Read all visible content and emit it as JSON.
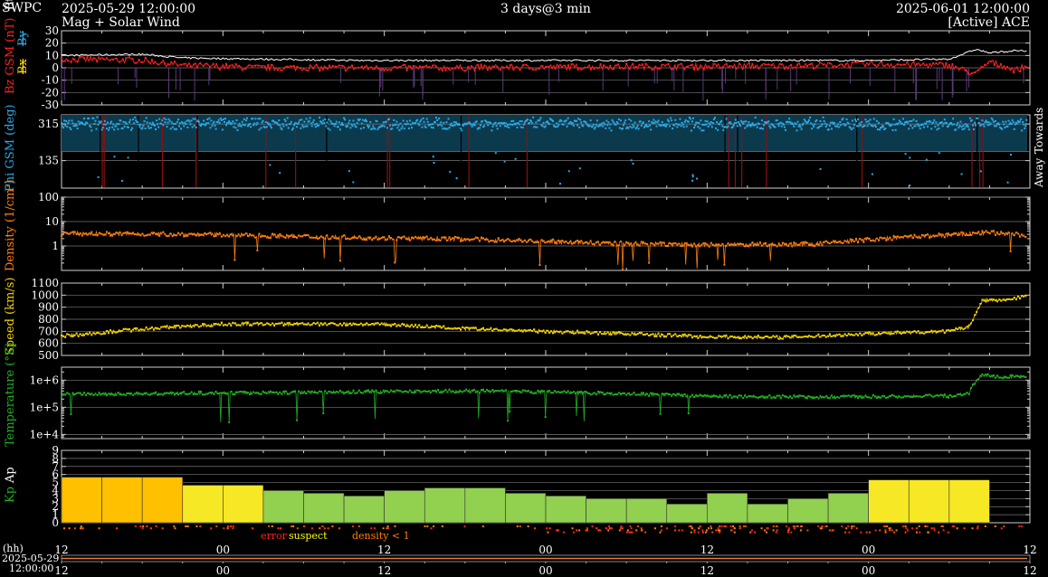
{
  "header": {
    "org": "SWPC",
    "start_time": "2025-05-29 12:00:00",
    "span": "3 days@3 min",
    "end_time": "2025-06-01 12:00:00",
    "title": "Mag + Solar Wind",
    "source": "[Active] ACE"
  },
  "colors": {
    "bz": "#ff2020",
    "bt": "#ffffff",
    "bx": "#ffd700",
    "by": "#29a9e8",
    "phi": "#29a9e8",
    "phi_fill": "#0b3a4d",
    "density": "#ff7f10",
    "speed": "#f2d200",
    "temp": "#22b022",
    "kp_green": "#92d050",
    "kp_yellow": "#f6e824",
    "kp_orange": "#ffc000",
    "error": "#ff2020",
    "suspect": "#ffff00",
    "low_density": "#ff7f10",
    "grid": "#777777"
  },
  "legend": {
    "error": "error",
    "suspect": "suspect",
    "density": "density < 1"
  },
  "chart_data": [
    {
      "type": "line",
      "name": "mag",
      "ylabel_parts": [
        "Bz GSM (nT)",
        "Bt"
      ],
      "sublabel_parts": [
        "Bx",
        "By"
      ],
      "ylim": [
        -30,
        30
      ],
      "yticks": [
        30,
        20,
        10,
        0,
        -10,
        -20,
        -30
      ],
      "x_hours": [
        0,
        6,
        9,
        15,
        22,
        30,
        40,
        48,
        56,
        60,
        66,
        68,
        69,
        71,
        72
      ],
      "bt": [
        10,
        11,
        8,
        7,
        6,
        6,
        6,
        6,
        6,
        6,
        7,
        15,
        12,
        14,
        13
      ],
      "bz": [
        7,
        6,
        2,
        0,
        0,
        0,
        1,
        1,
        2,
        3,
        2,
        -5,
        5,
        -2,
        3
      ]
    },
    {
      "type": "scatter",
      "name": "phi",
      "ylabel_parts": [
        "Phi GSM (deg)"
      ],
      "right_labels": [
        "Away",
        "Towards"
      ],
      "ylim": [
        0,
        360
      ],
      "yticks": [
        315,
        135
      ],
      "band_ylim": [
        180,
        360
      ],
      "typical": [
        300,
        330
      ]
    },
    {
      "type": "line",
      "name": "density",
      "ylabel": "Density (1/cm³)",
      "scale": "log",
      "ylim": [
        0.1,
        100
      ],
      "yticks": [
        "100",
        "10",
        "1"
      ],
      "x_hours": [
        0,
        10,
        20,
        30,
        40,
        48,
        56,
        60,
        66,
        69,
        71.5
      ],
      "values": [
        3.2,
        3.0,
        2.3,
        1.9,
        1.3,
        1.1,
        1.2,
        1.8,
        2.8,
        3.5,
        2.8
      ]
    },
    {
      "type": "line",
      "name": "speed",
      "ylabel": "Speed (km/s)",
      "ylim": [
        500,
        1100
      ],
      "yticks": [
        1100,
        1000,
        900,
        800,
        700,
        600,
        500
      ],
      "x_hours": [
        0,
        6,
        12,
        18,
        24,
        30,
        36,
        42,
        48,
        54,
        60,
        66,
        67.5,
        68.5,
        70,
        71.5
      ],
      "values": [
        660,
        720,
        760,
        760,
        760,
        720,
        700,
        680,
        655,
        650,
        680,
        700,
        740,
        960,
        955,
        990
      ]
    },
    {
      "type": "line",
      "name": "temperature",
      "ylabel": "Temperature (°K)",
      "scale": "log",
      "ylim": [
        7000,
        3000000
      ],
      "yticks": [
        "1e+6",
        "1e+5",
        "1e+4"
      ],
      "x_hours": [
        0,
        10,
        20,
        30,
        40,
        48,
        56,
        60,
        66,
        67.5,
        68.5,
        70,
        71.5
      ],
      "values": [
        300000,
        330000,
        360000,
        400000,
        330000,
        260000,
        240000,
        250000,
        260000,
        330000,
        1500000,
        1300000,
        1400000
      ]
    },
    {
      "type": "bar",
      "name": "kp",
      "ylabel_parts": [
        "Kp",
        "Ap"
      ],
      "ylim": [
        0,
        9
      ],
      "yticks": [
        9,
        8,
        7,
        6,
        5,
        4,
        3,
        2,
        1,
        0
      ],
      "bar_hours": 3,
      "values": [
        5.67,
        5.67,
        5.67,
        4.67,
        4.67,
        4.0,
        3.67,
        3.33,
        4.0,
        4.33,
        4.33,
        3.67,
        3.33,
        3.0,
        3.0,
        2.33,
        3.67,
        2.33,
        3.0,
        3.67,
        5.33,
        5.33,
        5.33,
        0
      ]
    }
  ],
  "xaxis": {
    "unit": "(hh)",
    "start_date": "2025-05-29",
    "start_clock": "12:00:00",
    "tick_labels": [
      "12",
      "00",
      "12",
      "00",
      "12",
      "00",
      "12"
    ],
    "tick_hours": [
      0,
      12,
      24,
      36,
      48,
      60,
      72
    ]
  }
}
